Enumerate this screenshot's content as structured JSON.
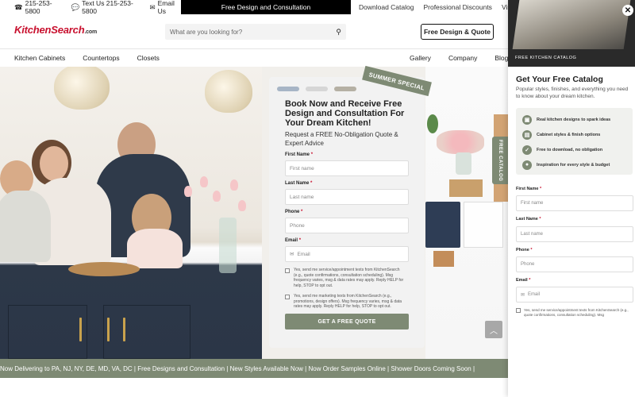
{
  "topbar": {
    "phone": "215-253-5800",
    "text_us": "Text Us 215-253-5800",
    "email": "Email Us",
    "promo": "Free Design and Consultation",
    "links": [
      "Download Catalog",
      "Professional Discounts",
      "Visit Sho"
    ]
  },
  "header": {
    "logo_main": "KitchenSearch",
    "logo_suffix": ".com",
    "search_placeholder": "What are you looking for?",
    "cta": "Free Design & Quote"
  },
  "nav": {
    "left": [
      "Kitchen Cabinets",
      "Countertops",
      "Closets"
    ],
    "right": [
      "Gallery",
      "Company",
      "Blog"
    ]
  },
  "form": {
    "ribbon": "SUMMER SPECIAL",
    "title": "Book Now and Receive Free Design and Consultation For Your Dream Kitchen!",
    "subtitle": "Request a FREE No-Obligation Quote & Expert Advice",
    "fields": [
      {
        "label": "First Name",
        "placeholder": "First name"
      },
      {
        "label": "Last Name",
        "placeholder": "Last name"
      },
      {
        "label": "Phone",
        "placeholder": "Phone"
      },
      {
        "label": "Email",
        "placeholder": "Email"
      }
    ],
    "consent_service": "Yes, send me service/appointment texts from KitchenSearch (e.g., quote confirmations, consultation scheduling). Msg frequency varies, msg & data rates may apply. Reply HELP for help, STOP to opt out.",
    "consent_marketing": "Yes, send me marketing texts from KitchenSearch (e.g., promotions, design offers). Msg frequency varies, msg & data rates may apply. Reply HELP for help, STOP to opt out.",
    "submit": "GET A FREE QUOTE",
    "dot_colors": [
      "#a7b5c6",
      "#d6d6d6",
      "#b5b0a4"
    ]
  },
  "catalog_tab": "FREE CATALOG",
  "ticker": "Now Delivering to PA, NJ, NY, DE, MD, VA, DC |  Free Designs and Consultation |  New Styles Available Now |  Now Order Samples Online |  Shower Doors Coming Soon |",
  "drawer": {
    "caption": "FREE KITCHEN CATALOG",
    "title": "Get Your Free Catalog",
    "subtitle": "Popular styles, finishes, and everything you need to know about your dream kitchen.",
    "features": [
      {
        "icon": "image-icon",
        "text": "Real kitchen designs to spark ideas"
      },
      {
        "icon": "cabinet-icon",
        "text": "Cabinet styles & finish options"
      },
      {
        "icon": "check-icon",
        "text": "Free to download, no obligation"
      },
      {
        "icon": "bulb-icon",
        "text": "Inspiration for every style & budget"
      }
    ],
    "fields": [
      {
        "label": "First Name",
        "placeholder": "First name"
      },
      {
        "label": "Last Name",
        "placeholder": "Last name"
      },
      {
        "label": "Phone",
        "placeholder": "Phone"
      },
      {
        "label": "Email",
        "placeholder": "Email"
      }
    ],
    "consent": "Yes, send me service/appointment texts from KitchenSearch (e.g., quote confirmations, consultation scheduling). Msg"
  },
  "colors": {
    "brand_red": "#c8102e",
    "sage": "#7e8a74",
    "navy_cabinet": "#2b3647"
  }
}
